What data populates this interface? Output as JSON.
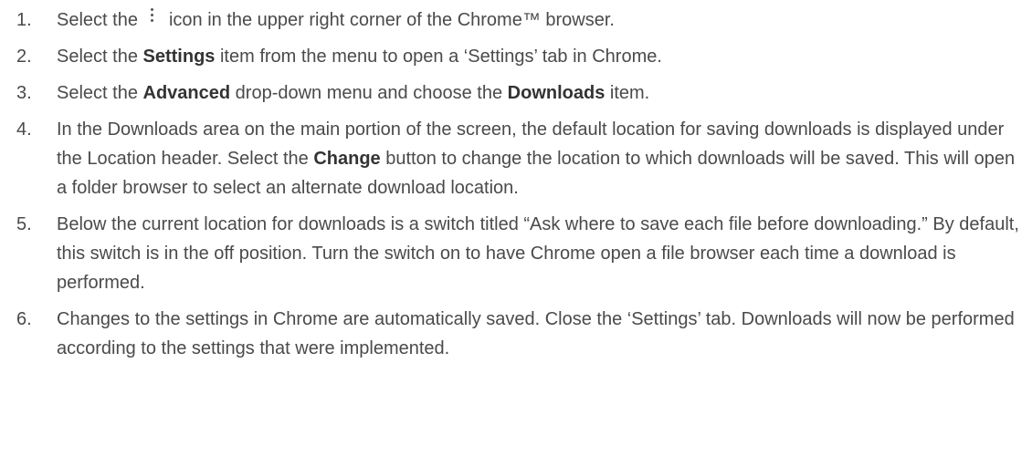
{
  "steps": [
    {
      "number": "1.",
      "before": "Select the",
      "icon": "more-vert-icon",
      "after": "icon in the upper right corner of the Chrome™ browser."
    },
    {
      "number": "2.",
      "before": "Select the ",
      "bold": "Settings",
      "after": " item from the menu to open a ‘Settings’ tab in Chrome."
    },
    {
      "number": "3.",
      "before": "Select the ",
      "bold1": "Advanced",
      "middle": " drop-down menu and choose the ",
      "bold2": "Downloads",
      "after": " item."
    },
    {
      "number": "4.",
      "before": "In the Downloads area on the main portion of the screen, the default location for saving downloads is displayed under the Location header. Select the ",
      "bold": "Change",
      "after": " button to change the location to which downloads will be saved. This will open a folder browser to select an alternate download location."
    },
    {
      "number": "5.",
      "text": "Below the current location for downloads is a switch titled “Ask where to save each file before downloading.” By default, this switch is in the off position. Turn the switch on to have Chrome open a file browser each time a download is performed."
    },
    {
      "number": "6.",
      "text": "Changes to the settings in Chrome are automatically saved. Close the ‘Settings’ tab. Downloads will now be performed according to the settings that were implemented."
    }
  ]
}
